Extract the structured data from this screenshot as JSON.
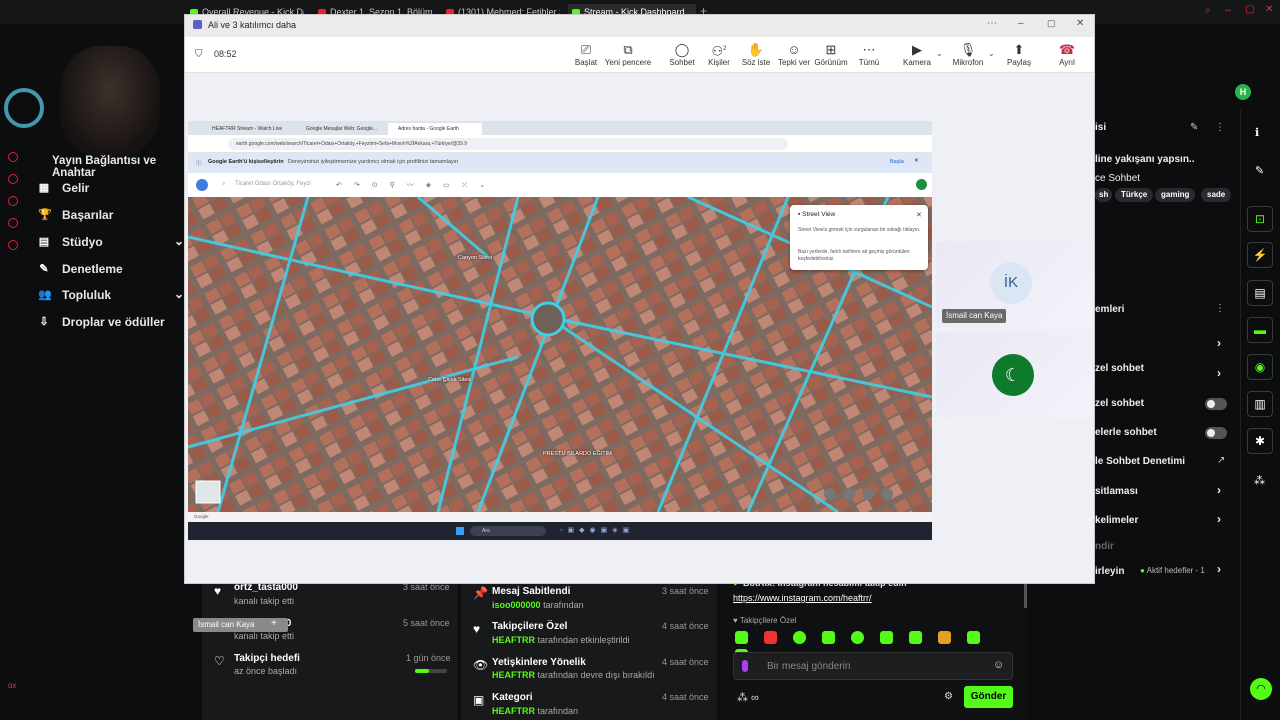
{
  "browser": {
    "tabs": [
      "Overall Revenue - Kick Da",
      "Dexter 1. Sezon 1. Bölüm",
      "(1301) Mehmed: Fetihler S",
      "Stream - Kick Dashboard"
    ]
  },
  "kick": {
    "section_title": "Yayın Bağlantısı ve Anahtar",
    "nav": [
      {
        "label": "Gelir",
        "icon": "money-icon"
      },
      {
        "label": "Başarılar",
        "icon": "trophy-icon"
      },
      {
        "label": "Stüdyo",
        "icon": "studio-icon"
      },
      {
        "label": "Denetleme",
        "icon": "wrench-icon"
      },
      {
        "label": "Topluluk",
        "icon": "community-icon"
      },
      {
        "label": "Droplar ve ödüller",
        "icon": "drops-icon"
      }
    ],
    "avatar_letter": "H",
    "stream_info": {
      "title_fragment": "isi",
      "desc": "line yakışanı yapsın..",
      "category": "ce Sohbet",
      "tags": [
        "sh",
        "Türkçe",
        "gaming",
        "sade"
      ]
    },
    "chat_settings": {
      "title_fragment": "emleri",
      "items": [
        "zel sohbet",
        "zel sohbet",
        "elerle sohbet",
        "le Sohbet Denetimi",
        "sitlaması",
        "kelimeler",
        "ndir",
        "irleyin"
      ],
      "goals_label": "Aktif hedefler - 1"
    },
    "followers": [
      {
        "name": "ortz_tasta000",
        "action": "kanalı takip etti",
        "time": "3 saat önce"
      },
      {
        "name": "melekakdd0",
        "action": "kanalı takip etti",
        "time": "5 saat önce"
      },
      {
        "name": "Takipçi hedefi",
        "action": "az önce başladı",
        "time": "1 gün önce"
      }
    ],
    "events": [
      {
        "title": "Mesaj Sabitlendi",
        "user": "isoo000000",
        "suffix": "tarafından",
        "time": "3 saat önce"
      },
      {
        "title": "Takipçilere Özel",
        "user": "HEAFTRR",
        "suffix": "tarafından etkinleştirildi",
        "time": "4 saat önce"
      },
      {
        "title": "Yetişkinlere Yönelik",
        "user": "HEAFTRR",
        "suffix": "tarafından devre dışı bırakıldı",
        "time": "4 saat önce"
      },
      {
        "title": "Kategori",
        "user": "HEAFTRR",
        "suffix": "tarafından",
        "time": "4 saat önce"
      }
    ],
    "chat": {
      "bot_line": "BotRix: Instagram hesabımı takip edin",
      "bot_link": "https://www.instagram.com/heaftrr/",
      "followers_only": "Takipçilere Özel",
      "placeholder": "Bir mesaj gönderin",
      "send": "Gönder"
    }
  },
  "teams": {
    "title": "Ali ve 3 katılımcı daha",
    "timer": "08:52",
    "toolbar": [
      {
        "label": "Başlat",
        "icon": "start-icon"
      },
      {
        "label": "Yeni pencere",
        "icon": "new-window-icon"
      },
      {
        "label": "Sohbet",
        "icon": "chat-icon"
      },
      {
        "label": "Kişiler",
        "icon": "people-icon",
        "badge": "2"
      },
      {
        "label": "Söz iste",
        "icon": "raise-hand-icon"
      },
      {
        "label": "Tepki ver",
        "icon": "react-icon"
      },
      {
        "label": "Görünüm",
        "icon": "view-icon"
      },
      {
        "label": "Tümü",
        "icon": "more-icon"
      },
      {
        "label": "Kamera",
        "icon": "camera-icon"
      },
      {
        "label": "Mikrofon",
        "icon": "mic-icon"
      },
      {
        "label": "Paylaş",
        "icon": "share-icon"
      },
      {
        "label": "Ayrıl",
        "icon": "leave-icon"
      }
    ],
    "participant1": {
      "initials": "İK",
      "name": "İsmail can Kaya"
    },
    "self_label": "İsmail can Kaya"
  },
  "shared": {
    "tabs": [
      "HEAFTRR Stream - Watch Live",
      "Google Mesajlar Web: Google...",
      "Adres harita - Google Earth"
    ],
    "url": "earth.google.com/web/search/Ticaret+Odası+Ortaköy,+Feyzimi+Sefa+Mısırlı%2fAnkara,+Türkiye/@39.9",
    "infobar_text": "Google Earth'ü kişiselleştirin",
    "infobar_desc": "Deneyiminizi iyileştirmemize yardımcı olmak için profilinizi tamamlayın",
    "infobar_action": "Başla",
    "search_placeholder": "Ticaret Odası Ortaköy, Feyzi",
    "street_view_title": "Street View",
    "street_view_text": "Street View'a girmek için vurgulanan bir sokağı tıklayın.",
    "street_view_text2": "Bazı yerlerde, farklı tarihlere ait geçmiş görüntüleri keşfedebilirsiniz.",
    "map_labels": [
      "Canyon Sitesi",
      "Cebe Çiçek Sitesi",
      "PRESTİJ BİLARDO EĞİTİM"
    ],
    "taskbar_search": "Ara"
  }
}
